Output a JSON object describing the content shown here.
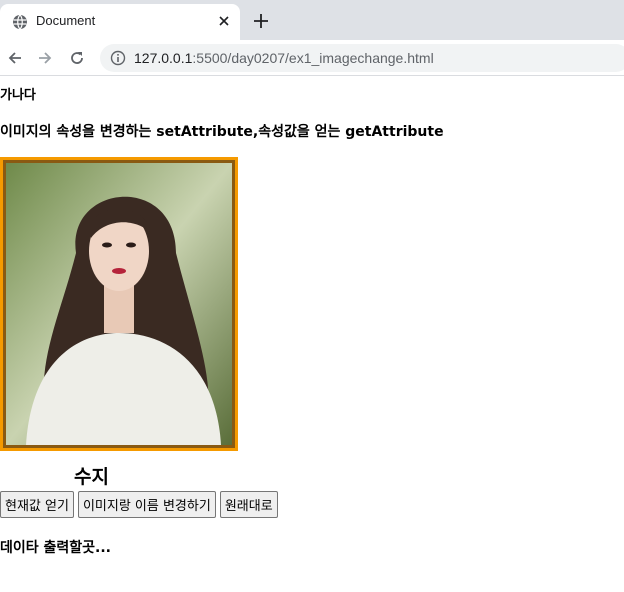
{
  "browser": {
    "tab_title": "Document",
    "url_host": "127.0.0.1",
    "url_path": ":5500/day0207/ex1_imagechange.html"
  },
  "page": {
    "greeting": "가나다",
    "subtitle": "이미지의 속성을 변경하는 setAttribute,속성값을 얻는 getAttribute",
    "caption": "수지",
    "buttons": {
      "get_current": "현재값 얻기",
      "change": "이미지랑 이름 변경하기",
      "reset": "원래대로"
    },
    "output_text": "데이타 출력할곳..."
  },
  "colors": {
    "frame_border": "#f59a00"
  }
}
